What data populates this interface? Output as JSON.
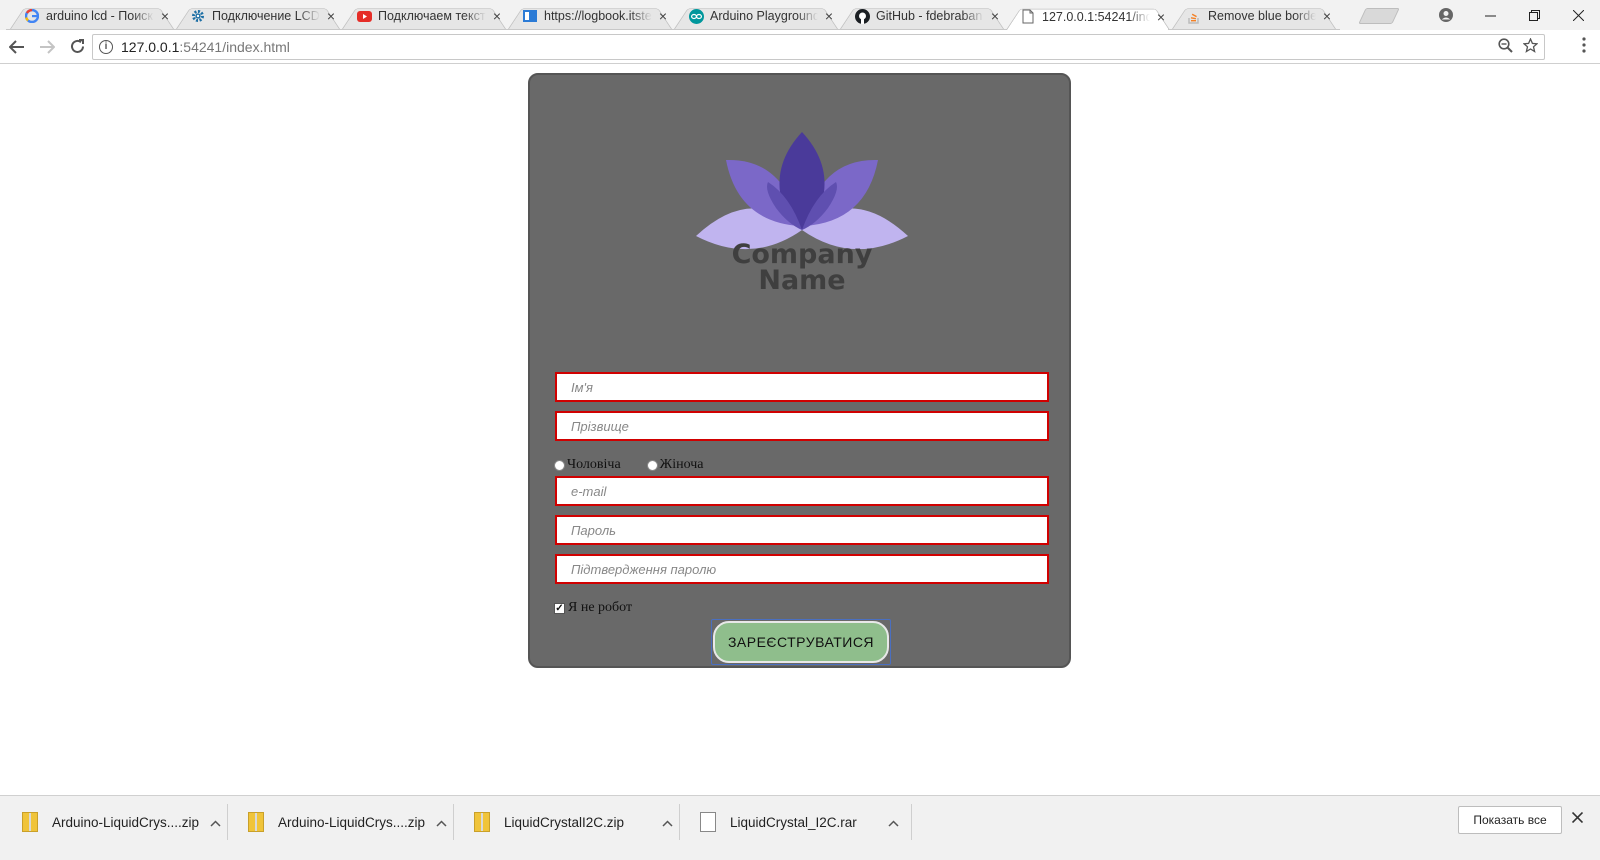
{
  "browser": {
    "tabs": [
      {
        "title": "arduino lcd - Поиск",
        "icon": "google-icon"
      },
      {
        "title": "Подключение LCD",
        "icon": "gear-icon"
      },
      {
        "title": "Подключаем тексто",
        "icon": "youtube-icon"
      },
      {
        "title": "https://logbook.itste",
        "icon": "logbook-icon"
      },
      {
        "title": "Arduino Playground",
        "icon": "arduino-icon"
      },
      {
        "title": "GitHub - fdebraban",
        "icon": "github-icon"
      },
      {
        "title": "127.0.0.1:54241/inde",
        "icon": "page-icon"
      },
      {
        "title": "Remove blue borde",
        "icon": "stackoverflow-icon"
      }
    ],
    "active_tab": 6,
    "url_host": "127.0.0.1",
    "url_rest": ":54241/index.html",
    "close_glyph": "×",
    "colors": {
      "tab_active": "#ffffff",
      "tab_inactive": "#e6e6e6"
    }
  },
  "form": {
    "logo": {
      "line1": "Company",
      "line2": "Name",
      "colors": {
        "petal_dark": "#4a3a9a",
        "petal_mid": "#7b68c8",
        "petal_light": "#c0b4ef"
      }
    },
    "fields": {
      "first_name": "Ім'я",
      "last_name": "Прізвище",
      "email": "e-mail",
      "password": "Пароль",
      "password_confirm": "Підтвердження паролю"
    },
    "gender": {
      "male": "Чоловіча",
      "female": "Жіноча"
    },
    "robot_label": "Я не робот",
    "robot_checked": true,
    "submit_label": "ЗАРЕЄСТРУВАТИСЯ",
    "colors": {
      "card": "#696969",
      "field_border": "#d00000",
      "button": "#8fbe8c"
    }
  },
  "downloads": {
    "items": [
      {
        "name": "Arduino-LiquidCrys....zip",
        "icon": "zip-icon"
      },
      {
        "name": "Arduino-LiquidCrys....zip",
        "icon": "zip-icon"
      },
      {
        "name": "LiquidCrystalI2C.zip",
        "icon": "zip-icon"
      },
      {
        "name": "LiquidCrystal_I2C.rar",
        "icon": "file-icon"
      }
    ],
    "show_all_label": "Показать все"
  }
}
